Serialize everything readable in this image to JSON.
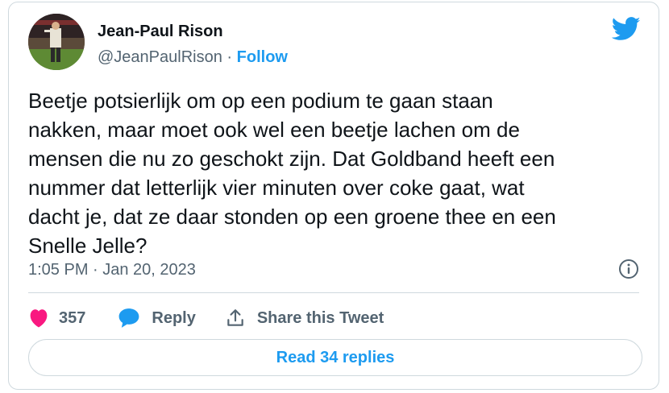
{
  "author": {
    "name": "Jean-Paul Rison",
    "handle": "@JeanPaulRison",
    "separator": "·",
    "follow_label": "Follow"
  },
  "tweet": {
    "text": "Beetje potsierlijk om op een podium te gaan staan\nnakken, maar moet ook wel een beetje lachen om de\nmensen die nu zo geschokt zijn. Dat Goldband heeft een\nnummer dat letterlijk vier minuten over coke gaat, wat\ndacht je, dat ze daar stonden op een groene thee en een\nSnelle Jelle?",
    "timestamp": "1:05 PM · Jan 20, 2023"
  },
  "actions": {
    "likes_count": "357",
    "reply_label": "Reply",
    "share_label": "Share this Tweet"
  },
  "footer": {
    "read_replies_label": "Read 34 replies"
  },
  "icons": {
    "brand": "twitter-bird-icon",
    "info": "info-icon",
    "like": "heart-icon",
    "reply": "speech-bubble-icon",
    "share": "share-upload-icon"
  },
  "colors": {
    "accent": "#1d9bf0",
    "like": "#f91880",
    "secondary_text": "#536471",
    "border": "#cfd9de"
  }
}
